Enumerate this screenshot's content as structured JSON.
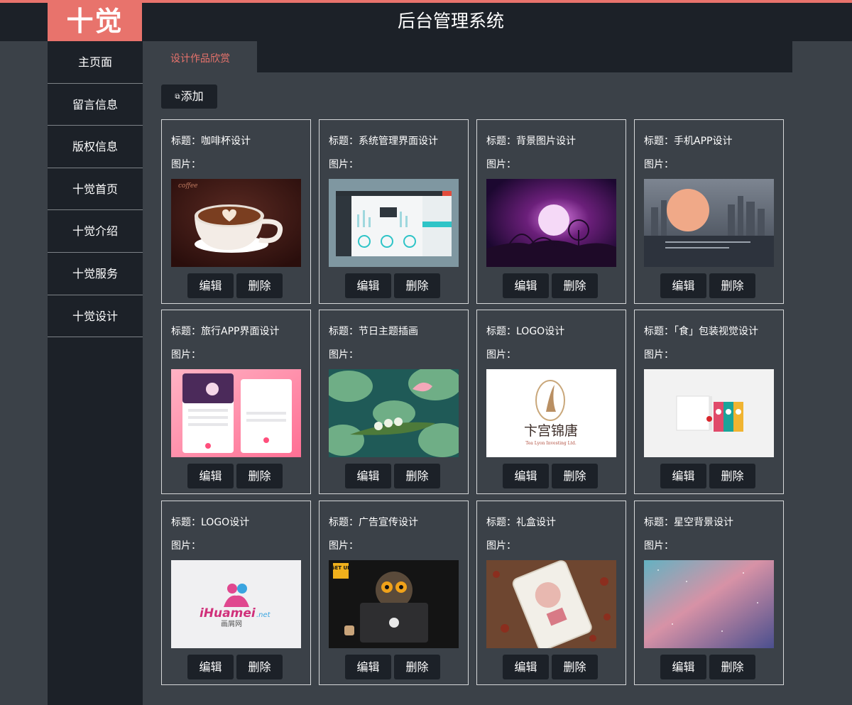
{
  "brand": {
    "logo": "十觉",
    "title": "后台管理系统",
    "accent": "#e8736c"
  },
  "sidebar": {
    "items": [
      {
        "label": "主页面"
      },
      {
        "label": "留言信息"
      },
      {
        "label": "版权信息"
      },
      {
        "label": "十觉首页"
      },
      {
        "label": "十觉介绍"
      },
      {
        "label": "十觉服务"
      },
      {
        "label": "十觉设计"
      }
    ]
  },
  "tabs": {
    "active": "设计作品欣赏"
  },
  "toolbar": {
    "add_icon": "copy-icon",
    "add_label": "添加"
  },
  "card_labels": {
    "image": "图片：",
    "edit": "编辑",
    "delete": "删除"
  },
  "cards": [
    {
      "title": "标题：咖啡杯设计",
      "thumb": "coffee-cup-image",
      "thumb_text": "coffee"
    },
    {
      "title": "标题：系统管理界面设计",
      "thumb": "dashboard-ui-image"
    },
    {
      "title": "标题：背景图片设计",
      "thumb": "purple-night-scene-image"
    },
    {
      "title": "标题：手机APP设计",
      "thumb": "city-skyline-app-image"
    },
    {
      "title": "标题：旅行APP界面设计",
      "thumb": "pink-travel-app-image"
    },
    {
      "title": "标题：节日主题插画",
      "thumb": "lotus-leaf-illustration-image"
    },
    {
      "title": "标题：LOGO设计",
      "thumb": "calligraphy-logo-image",
      "thumb_text": "卞宫锦唐",
      "thumb_subtext": "Tea Lyon Investing Ltd."
    },
    {
      "title": "标题：「食」包装视觉设计",
      "thumb": "food-packaging-image"
    },
    {
      "title": "标题：LOGO设计",
      "thumb": "ihuamei-logo-image",
      "thumb_text": "iHuamei",
      "thumb_text2": ".net",
      "thumb_subtext": "画屑网"
    },
    {
      "title": "标题：广告宣传设计",
      "thumb": "owl-laptop-ad-image",
      "thumb_text": "GET UP"
    },
    {
      "title": "标题：礼盒设计",
      "thumb": "gift-box-phone-image"
    },
    {
      "title": "标题：星空背景设计",
      "thumb": "starry-gradient-image"
    }
  ]
}
